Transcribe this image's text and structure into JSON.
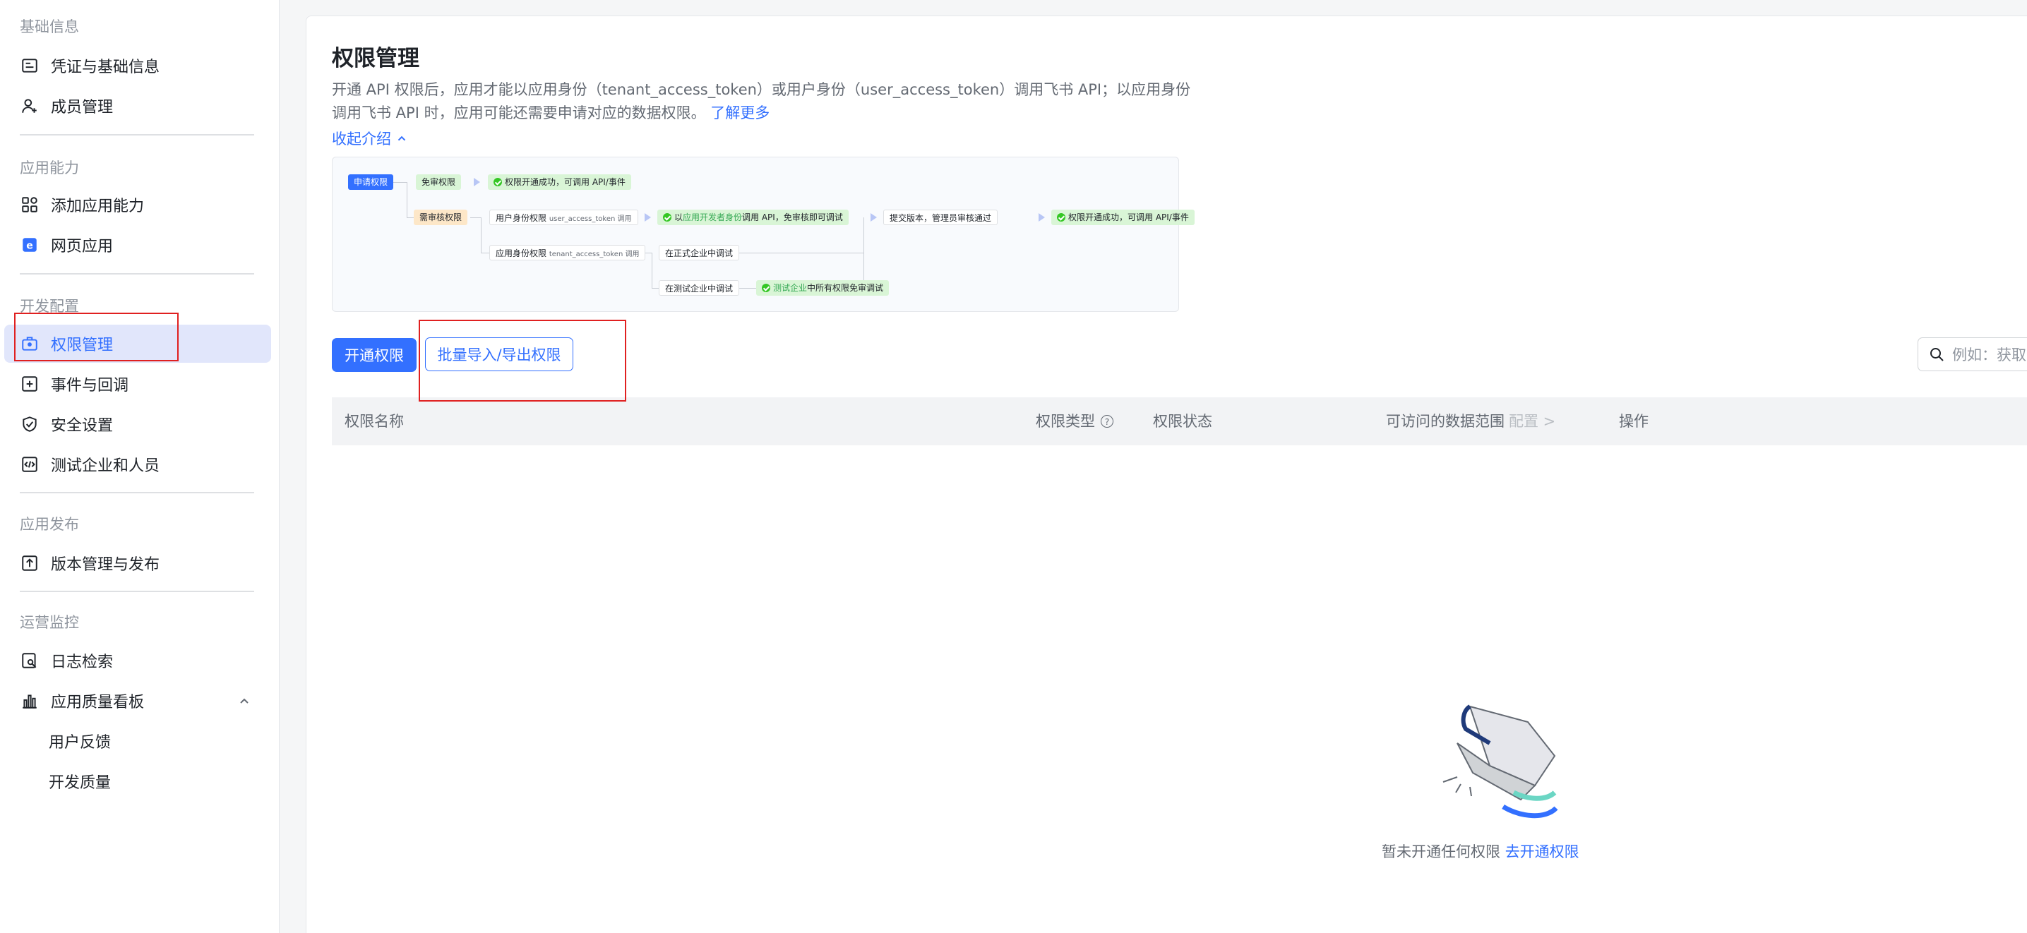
{
  "sidebar": {
    "sections": [
      {
        "title": "基础信息"
      },
      {
        "title": "应用能力"
      },
      {
        "title": "开发配置"
      },
      {
        "title": "应用发布"
      },
      {
        "title": "运营监控"
      }
    ],
    "items": {
      "credentials": "凭证与基础信息",
      "members": "成员管理",
      "add_capability": "添加应用能力",
      "web_app": "网页应用",
      "permissions": "权限管理",
      "events": "事件与回调",
      "security": "安全设置",
      "test_company": "测试企业和人员",
      "versions": "版本管理与发布",
      "log_search": "日志检索",
      "quality_board": "应用质量看板",
      "feedback": "用户反馈",
      "dev_quality": "开发质量"
    },
    "active_item": "permissions"
  },
  "main": {
    "title": "权限管理",
    "description": "开通 API 权限后，应用才能以应用身份（tenant_access_token）或用户身份（user_access_token）调用飞书 API；以应用身份调用飞书 API 时，应用可能还需要申请对应的数据权限。",
    "learn_more": "了解更多",
    "collapse_intro": "收起介绍",
    "flow": {
      "apply": "申请权限",
      "no_review": "免审权限",
      "success1": "权限开通成功，可调用 API/事件",
      "need_review": "需审核权限",
      "user_identity": "用户身份权限",
      "user_token": "user_access_token 调用",
      "dev_call_pre": "以",
      "dev_call_green": "应用开发者身份",
      "dev_call_post": "调用 API，免审核即可调试",
      "submit": "提交版本，管理员审核通过",
      "success2": "权限开通成功，可调用 API/事件",
      "app_identity": "应用身份权限",
      "tenant_token": "tenant_access_token 调用",
      "formal_debug": "在正式企业中调试",
      "test_debug": "在测试企业中调试",
      "test_all_green": "测试企业",
      "test_all_post": "中所有权限免审调试"
    },
    "buttons": {
      "open_permission": "开通权限",
      "batch_import_export": "批量导入/导出权限"
    },
    "search_placeholder": "例如：获取",
    "table": {
      "columns": {
        "name": "权限名称",
        "type": "权限类型",
        "status": "权限状态",
        "scope": "可访问的数据范围",
        "scope_config": "配置 >",
        "action": "操作"
      }
    },
    "empty": {
      "text": "暂未开通任何权限",
      "link": "去开通权限"
    }
  },
  "colors": {
    "accent": "#3370ff",
    "highlight_box": "#e02020"
  }
}
